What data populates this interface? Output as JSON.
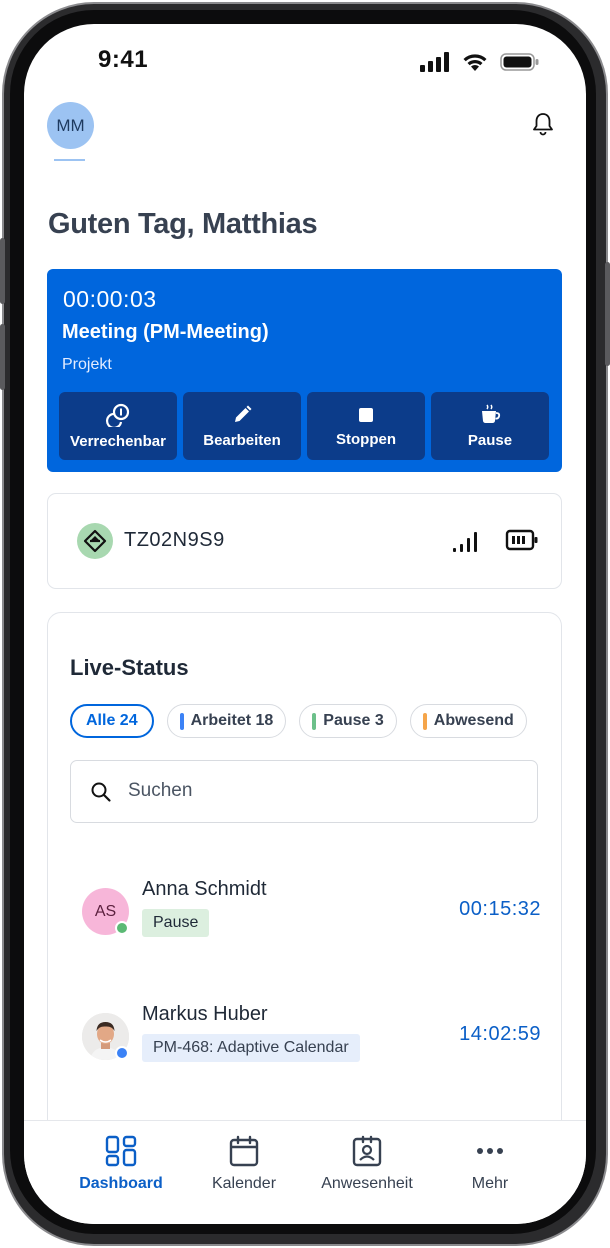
{
  "status_bar": {
    "time": "9:41"
  },
  "header": {
    "avatar_initials": "MM",
    "greeting": "Guten Tag, Matthias"
  },
  "timer": {
    "elapsed": "00:00:03",
    "title": "Meeting (PM-Meeting)",
    "subtitle": "Projekt",
    "actions": [
      {
        "label": "Verrechenbar",
        "icon": "billable-icon"
      },
      {
        "label": "Bearbeiten",
        "icon": "pencil-icon"
      },
      {
        "label": "Stoppen",
        "icon": "stop-icon"
      },
      {
        "label": "Pause",
        "icon": "coffee-icon"
      }
    ],
    "color": "#0066dd"
  },
  "device": {
    "name": "TZ02N9S9",
    "icon": "terminal-icon"
  },
  "live_status": {
    "title": "Live-Status",
    "filters": [
      {
        "label": "Alle 24",
        "active": true
      },
      {
        "label": "Arbeitet 18",
        "color": "#3b82f6"
      },
      {
        "label": "Pause 3",
        "color": "#6cc08a"
      },
      {
        "label": "Abwesend",
        "color": "#f5a54a"
      }
    ],
    "search": {
      "placeholder": "Suchen"
    },
    "people": [
      {
        "initials": "AS",
        "name": "Anna Schmidt",
        "status": "Pause",
        "time": "00:15:32",
        "dot_color": "#5bb974"
      },
      {
        "name": "Markus Huber",
        "status": "PM-468: Adaptive Calendar",
        "time": "14:02:59",
        "dot_color": "#3b82f6"
      }
    ]
  },
  "nav": {
    "items": [
      {
        "label": "Dashboard",
        "icon": "dashboard-icon",
        "active": true
      },
      {
        "label": "Kalender",
        "icon": "calendar-icon"
      },
      {
        "label": "Anwesenheit",
        "icon": "badge-icon"
      },
      {
        "label": "Mehr",
        "icon": "more-icon"
      }
    ]
  }
}
